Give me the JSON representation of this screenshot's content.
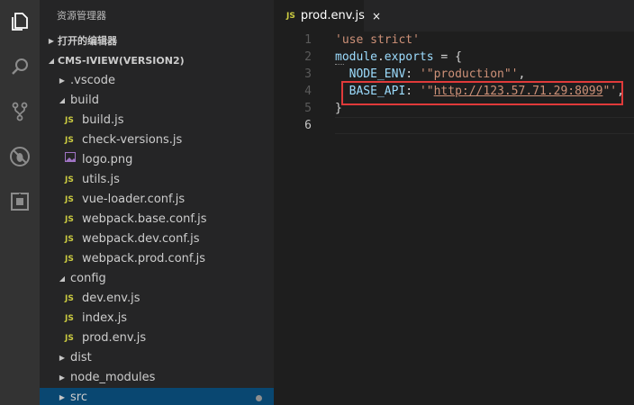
{
  "explorer": {
    "title": "资源管理器",
    "open_editors_label": "打开的编辑器",
    "project_label": "CMS-IVIEW(VERSION2)",
    "tree": [
      {
        "label": ".vscode",
        "kind": "folder",
        "expanded": false,
        "depth": 1
      },
      {
        "label": "build",
        "kind": "folder",
        "expanded": true,
        "depth": 1
      },
      {
        "label": "build.js",
        "kind": "js",
        "depth": 2
      },
      {
        "label": "check-versions.js",
        "kind": "js",
        "depth": 2
      },
      {
        "label": "logo.png",
        "kind": "image",
        "depth": 2
      },
      {
        "label": "utils.js",
        "kind": "js",
        "depth": 2
      },
      {
        "label": "vue-loader.conf.js",
        "kind": "js",
        "depth": 2
      },
      {
        "label": "webpack.base.conf.js",
        "kind": "js",
        "depth": 2
      },
      {
        "label": "webpack.dev.conf.js",
        "kind": "js",
        "depth": 2
      },
      {
        "label": "webpack.prod.conf.js",
        "kind": "js",
        "depth": 2
      },
      {
        "label": "config",
        "kind": "folder",
        "expanded": true,
        "depth": 1
      },
      {
        "label": "dev.env.js",
        "kind": "js",
        "depth": 2
      },
      {
        "label": "index.js",
        "kind": "js",
        "depth": 2
      },
      {
        "label": "prod.env.js",
        "kind": "js",
        "depth": 2
      },
      {
        "label": "dist",
        "kind": "folder",
        "expanded": false,
        "depth": 1
      },
      {
        "label": "node_modules",
        "kind": "folder",
        "expanded": false,
        "depth": 1
      },
      {
        "label": "src",
        "kind": "folder",
        "expanded": false,
        "depth": 1,
        "selected": true,
        "dirty": true
      }
    ]
  },
  "tab": {
    "badge": "JS",
    "label": "prod.env.js",
    "close": "×"
  },
  "code": {
    "line_numbers": [
      "1",
      "2",
      "3",
      "4",
      "5",
      "6"
    ],
    "line1": "'use strict'",
    "line2_a": "module",
    "line2_b": ".",
    "line2_c": "exports",
    "line2_d": " = {",
    "line3_key": "NODE_ENV",
    "line3_colon": ": ",
    "line3_val": "'\"production\"'",
    "line3_end": ",",
    "line4_key": "BASE_API",
    "line4_colon": ": ",
    "line4_q1": "'\"",
    "line4_url": "http://123.57.71.29:8099",
    "line4_q2": "\"'",
    "line4_end": ",",
    "line5": "}"
  },
  "colors": {
    "highlight_box": "#e03a3a",
    "selection": "#094771",
    "js_badge": "#cbcb41"
  }
}
